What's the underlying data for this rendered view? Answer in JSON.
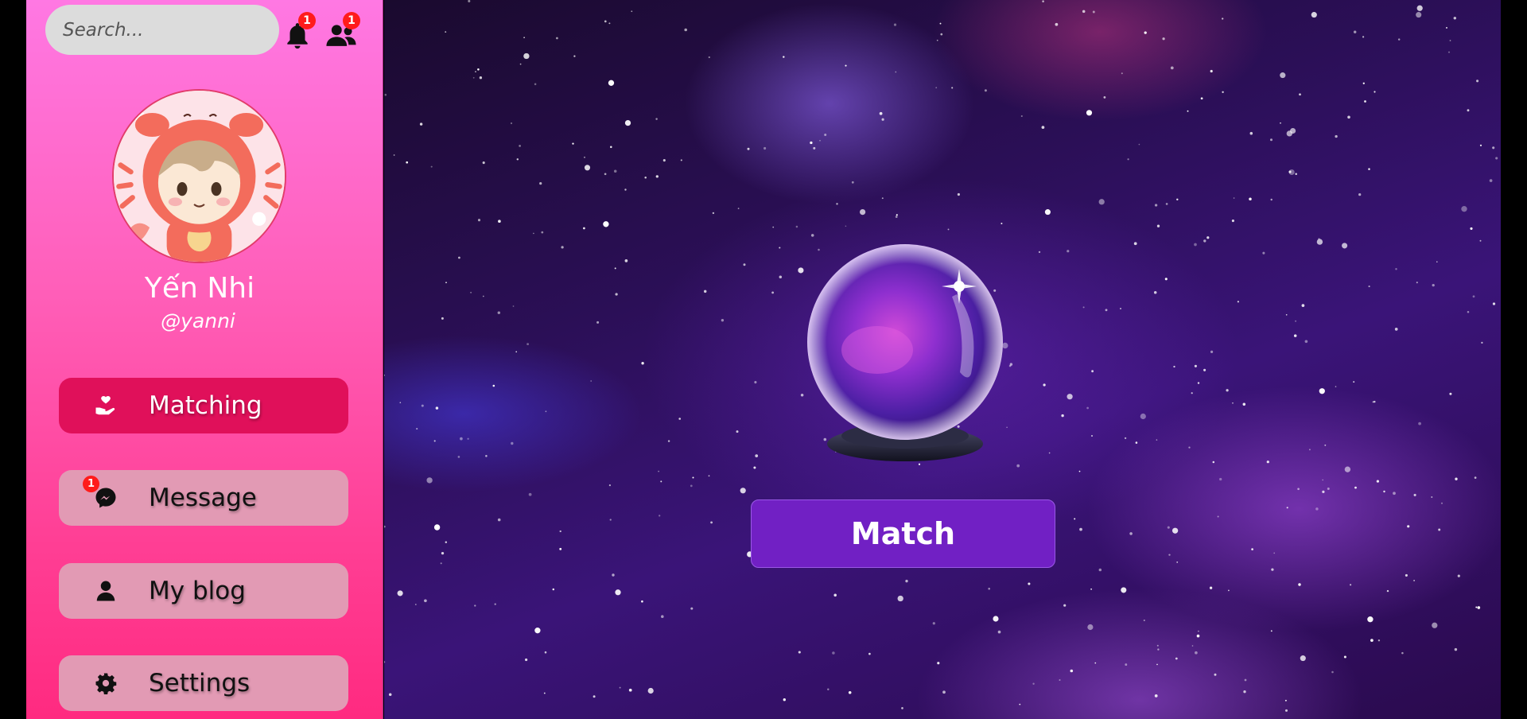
{
  "search": {
    "placeholder": "Search..."
  },
  "notifications": {
    "count": "1"
  },
  "friend_requests": {
    "count": "1"
  },
  "profile": {
    "name": "Yến Nhi",
    "handle": "@yanni"
  },
  "nav": {
    "matching": {
      "label": "Matching",
      "icon": "hand-heart-icon",
      "active": true
    },
    "message": {
      "label": "Message",
      "icon": "messenger-icon",
      "badge": "1"
    },
    "blog": {
      "label": "My blog",
      "icon": "user-icon"
    },
    "settings": {
      "label": "Settings",
      "icon": "gear-icon"
    }
  },
  "main": {
    "match_button": "Match"
  },
  "colors": {
    "sidebar_top": "#ff78e3",
    "sidebar_bottom": "#ff2a80",
    "nav_active": "#e0105a",
    "nav_inactive": "#e29ab4",
    "match_button": "#7120c4",
    "badge": "#ff1b1b"
  }
}
